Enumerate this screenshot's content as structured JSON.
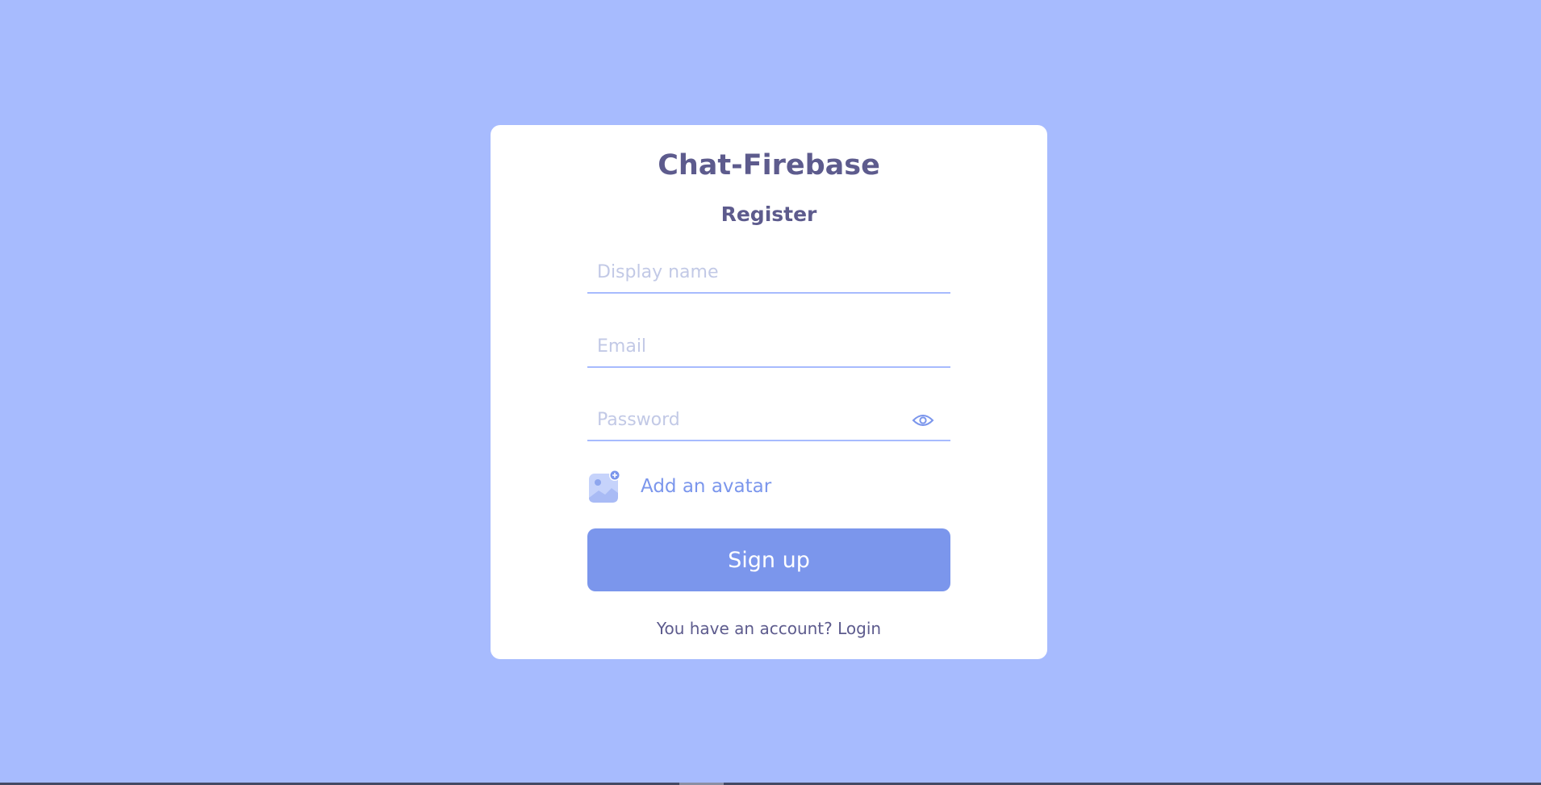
{
  "app": {
    "title": "Chat-Firebase"
  },
  "form": {
    "title": "Register",
    "display_name_placeholder": "Display name",
    "email_placeholder": "Email",
    "password_placeholder": "Password",
    "password_toggle_icon": "eye-icon",
    "avatar_icon": "add-image-icon",
    "avatar_label": "Add an avatar",
    "submit_label": "Sign up",
    "footer_prefix": "You have an account? ",
    "footer_link": "Login"
  },
  "colors": {
    "background": "#a7bbfe",
    "card": "#ffffff",
    "heading": "#5d5b8d",
    "accent": "#7b96ec",
    "placeholder": "#c2c9e6"
  }
}
